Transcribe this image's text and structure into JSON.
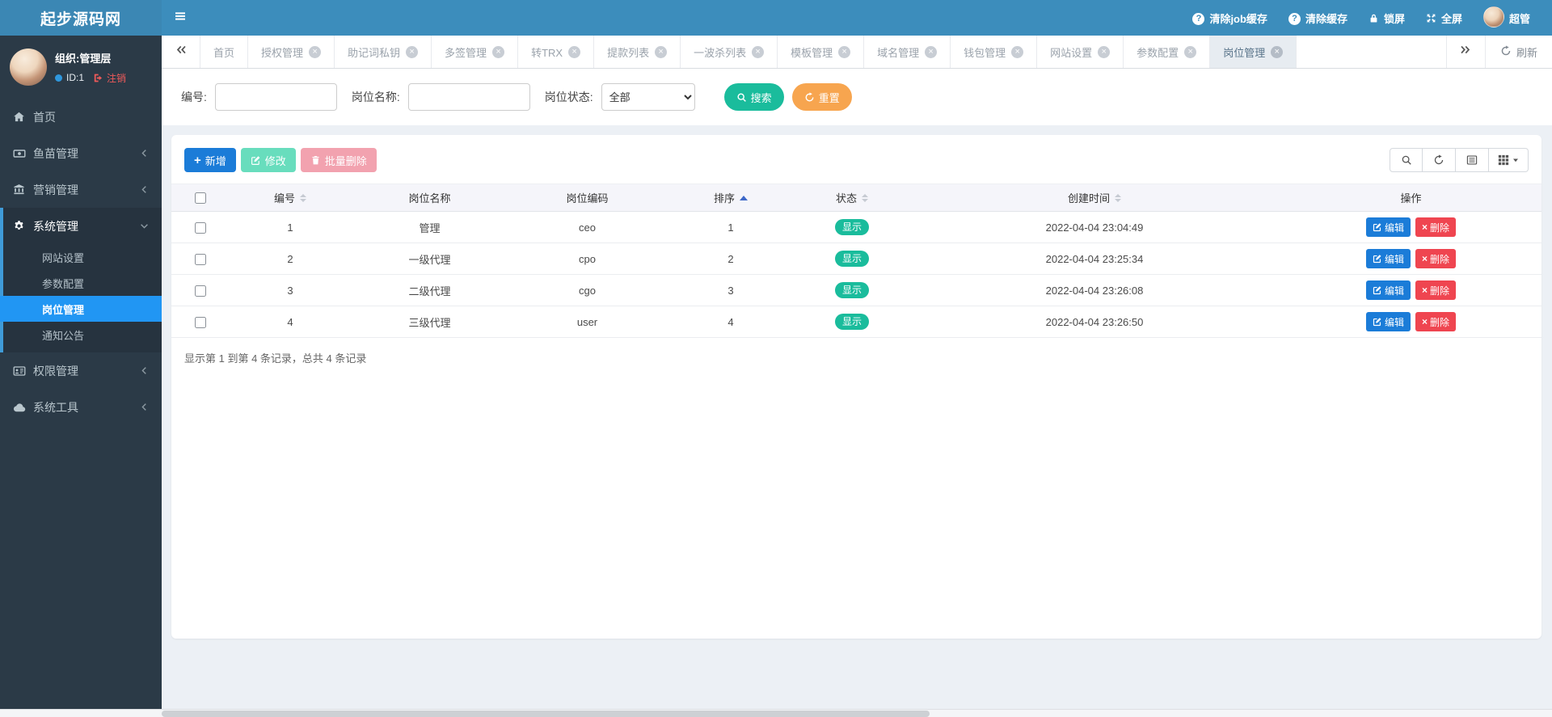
{
  "navbar": {
    "brand": "起步源码网",
    "actions": [
      {
        "name": "clear-job-cache",
        "icon": "question",
        "label": "清除job缓存"
      },
      {
        "name": "clear-cache",
        "icon": "question",
        "label": "清除缓存"
      },
      {
        "name": "lock-screen",
        "icon": "lock",
        "label": "锁屏"
      },
      {
        "name": "fullscreen",
        "icon": "expand",
        "label": "全屏"
      },
      {
        "name": "user-menu",
        "icon": "avatar",
        "label": "超管"
      }
    ]
  },
  "sidebar": {
    "user": {
      "org": "组织:管理层",
      "id": "ID:1",
      "logout": "注销"
    },
    "items": [
      {
        "name": "home",
        "icon": "home",
        "label": "首页",
        "state": "none"
      },
      {
        "name": "fry",
        "icon": "money",
        "label": "鱼苗管理",
        "state": "collapsed"
      },
      {
        "name": "market",
        "icon": "bank",
        "label": "营销管理",
        "state": "collapsed"
      },
      {
        "name": "system",
        "icon": "gear",
        "label": "系统管理",
        "state": "expanded",
        "children": [
          {
            "name": "site-settings",
            "label": "网站设置",
            "active": false
          },
          {
            "name": "param-config",
            "label": "参数配置",
            "active": false
          },
          {
            "name": "post-manage",
            "label": "岗位管理",
            "active": true
          },
          {
            "name": "notice",
            "label": "通知公告",
            "active": false
          }
        ]
      },
      {
        "name": "auth",
        "icon": "idcard",
        "label": "权限管理",
        "state": "collapsed"
      },
      {
        "name": "tools",
        "icon": "cloud",
        "label": "系统工具",
        "state": "collapsed"
      }
    ]
  },
  "tabs": {
    "items": [
      {
        "label": "首页",
        "closable": false,
        "active": false
      },
      {
        "label": "授权管理",
        "closable": true,
        "active": false
      },
      {
        "label": "助记词私钥",
        "closable": true,
        "active": false
      },
      {
        "label": "多签管理",
        "closable": true,
        "active": false
      },
      {
        "label": "转TRX",
        "closable": true,
        "active": false
      },
      {
        "label": "提款列表",
        "closable": true,
        "active": false
      },
      {
        "label": "一波杀列表",
        "closable": true,
        "active": false
      },
      {
        "label": "模板管理",
        "closable": true,
        "active": false
      },
      {
        "label": "域名管理",
        "closable": true,
        "active": false
      },
      {
        "label": "钱包管理",
        "closable": true,
        "active": false
      },
      {
        "label": "网站设置",
        "closable": true,
        "active": false
      },
      {
        "label": "参数配置",
        "closable": true,
        "active": false
      },
      {
        "label": "岗位管理",
        "closable": true,
        "active": true
      }
    ],
    "refresh_label": "刷新"
  },
  "filters": {
    "fields": [
      {
        "label": "编号:",
        "type": "text",
        "value": ""
      },
      {
        "label": "岗位名称:",
        "type": "text",
        "value": ""
      },
      {
        "label": "岗位状态:",
        "type": "select",
        "value": "全部"
      }
    ],
    "search_label": "搜索",
    "reset_label": "重置"
  },
  "toolbar": {
    "add_label": "新增",
    "edit_label": "修改",
    "batch_delete_label": "批量删除"
  },
  "table": {
    "columns": [
      {
        "label": "编号",
        "sortable": true,
        "sorted": null
      },
      {
        "label": "岗位名称",
        "sortable": false,
        "sorted": null
      },
      {
        "label": "岗位编码",
        "sortable": false,
        "sorted": null
      },
      {
        "label": "排序",
        "sortable": true,
        "sorted": "asc"
      },
      {
        "label": "状态",
        "sortable": true,
        "sorted": null
      },
      {
        "label": "创建时间",
        "sortable": true,
        "sorted": null
      },
      {
        "label": "操作",
        "sortable": false,
        "sorted": null
      }
    ],
    "rows": [
      {
        "id": "1",
        "name": "管理",
        "code": "ceo",
        "sort": "1",
        "status": "显示",
        "created": "2022-04-04 23:04:49"
      },
      {
        "id": "2",
        "name": "一级代理",
        "code": "cpo",
        "sort": "2",
        "status": "显示",
        "created": "2022-04-04 23:25:34"
      },
      {
        "id": "3",
        "name": "二级代理",
        "code": "cgo",
        "sort": "3",
        "status": "显示",
        "created": "2022-04-04 23:26:08"
      },
      {
        "id": "4",
        "name": "三级代理",
        "code": "user",
        "sort": "4",
        "status": "显示",
        "created": "2022-04-04 23:26:50"
      }
    ],
    "edit_label": "编辑",
    "delete_label": "删除",
    "summary": "显示第 1 到第 4 条记录，总共 4 条记录"
  },
  "colors": {
    "navbar": "#3c8dbc",
    "sidebar": "#2b3a47",
    "active_menu": "#2196f3",
    "teal": "#1abc9c",
    "orange": "#f7a54f",
    "primary": "#1b7cd8",
    "danger": "#ef4550"
  }
}
